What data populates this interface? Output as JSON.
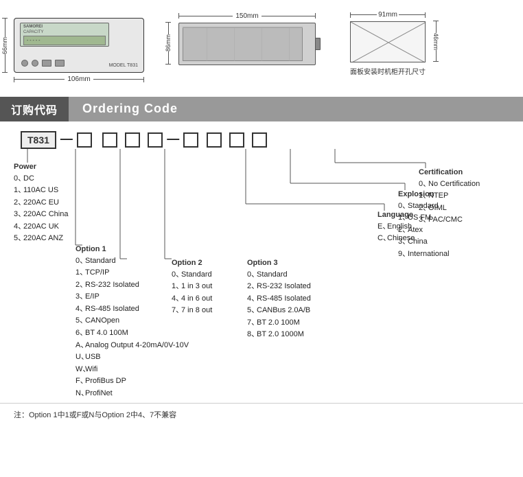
{
  "diagrams": {
    "front": {
      "dim_height": "66mm",
      "dim_width": "106mm",
      "model": "MODEL T831"
    },
    "side": {
      "dim_height": "86mm",
      "dim_width": "150mm"
    },
    "panel": {
      "dim_height": "46mm",
      "dim_width": "91mm",
      "caption": "面板安装时机柜开孔尺寸"
    }
  },
  "ordering": {
    "header_cn": "订购代码",
    "header_en": "Ordering Code",
    "model": "T831",
    "power": {
      "title": "Power",
      "items": [
        {
          "code": "0、",
          "label": "DC"
        },
        {
          "code": "1、",
          "label": "110AC US"
        },
        {
          "code": "2、",
          "label": "220AC EU"
        },
        {
          "code": "3、",
          "label": "220AC China"
        },
        {
          "code": "4、",
          "label": "220AC UK"
        },
        {
          "code": "5、",
          "label": "220AC ANZ"
        }
      ]
    },
    "option1": {
      "title": "Option 1",
      "items": [
        {
          "code": "0、",
          "label": "Standard"
        },
        {
          "code": "1、",
          "label": "TCP/IP"
        },
        {
          "code": "2、",
          "label": "RS-232 Isolated"
        },
        {
          "code": "3、",
          "label": "E/IP"
        },
        {
          "code": "4、",
          "label": "RS-485 Isolated"
        },
        {
          "code": "5、",
          "label": "CANOpen"
        },
        {
          "code": "6、",
          "label": "BT 4.0 100M"
        },
        {
          "code": "A、",
          "label": "Analog Output 4-20mA/0V-10V"
        },
        {
          "code": "U、",
          "label": "USB"
        },
        {
          "code": "W、",
          "label": "Wifi"
        },
        {
          "code": "F、",
          "label": "ProfiBus DP"
        },
        {
          "code": "N、",
          "label": "ProfiNet"
        }
      ]
    },
    "option2": {
      "title": "Option 2",
      "items": [
        {
          "code": "0、",
          "label": "Standard"
        },
        {
          "code": "1、",
          "label": "1 in 3 out"
        },
        {
          "code": "4、",
          "label": "4 in 6 out"
        },
        {
          "code": "7、",
          "label": "7 in 8 out"
        }
      ]
    },
    "option3": {
      "title": "Option 3",
      "items": [
        {
          "code": "0、",
          "label": "Standard"
        },
        {
          "code": "2、",
          "label": "RS-232 Isolated"
        },
        {
          "code": "4、",
          "label": "RS-485 Isolated"
        },
        {
          "code": "5、",
          "label": "CANBus 2.0A/B"
        },
        {
          "code": "7、",
          "label": "BT 2.0 100M"
        },
        {
          "code": "8、",
          "label": "BT 2.0 1000M"
        }
      ]
    },
    "language": {
      "title": "Language",
      "items": [
        {
          "code": "E、",
          "label": "English"
        },
        {
          "code": "C、",
          "label": "Chinese"
        }
      ]
    },
    "explosion": {
      "title": "Explosion",
      "items": [
        {
          "code": "0、",
          "label": "Standard"
        },
        {
          "code": "1、",
          "label": "US FM"
        },
        {
          "code": "2、",
          "label": "Atex"
        },
        {
          "code": "3、",
          "label": "China"
        },
        {
          "code": "9、",
          "label": "International"
        }
      ]
    },
    "certification": {
      "title": "Certification",
      "items": [
        {
          "code": "0、",
          "label": "No Certification"
        },
        {
          "code": "1、",
          "label": "NTEP"
        },
        {
          "code": "2、",
          "label": "OIML"
        },
        {
          "code": "3、",
          "label": "PAC/CMC"
        }
      ]
    }
  },
  "note": {
    "text": "注：Option 1中1或F或N与Option 2中4、7不兼容"
  }
}
